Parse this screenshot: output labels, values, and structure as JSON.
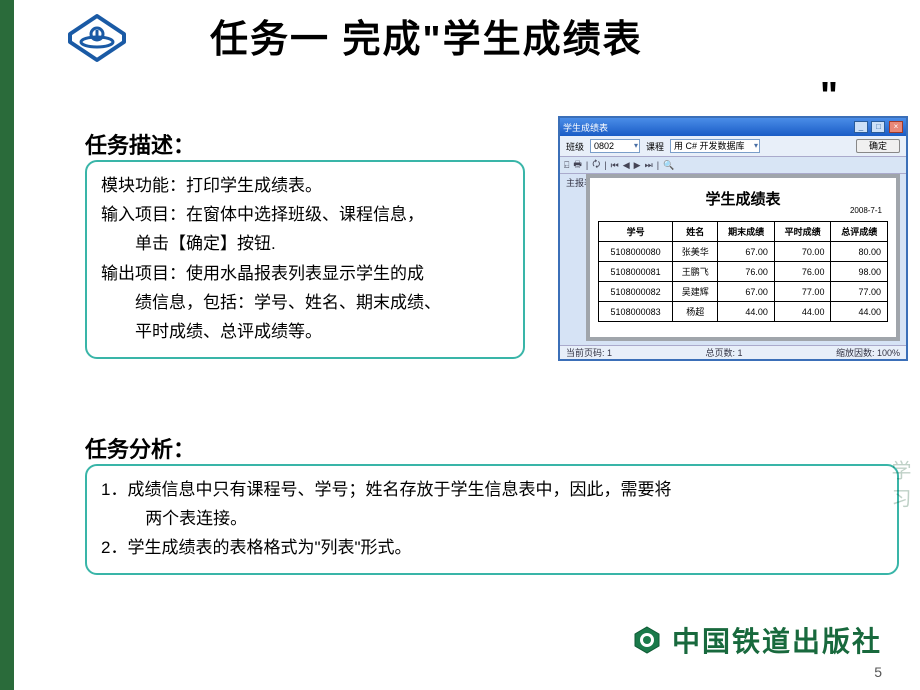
{
  "slide": {
    "title": "任务一  完成\"学生成绩表",
    "title_quote_end": "\"",
    "page_number": "5"
  },
  "task_description": {
    "heading": "任务描述：",
    "line_module": "模块功能：打印学生成绩表。",
    "line_input_a": "输入项目：在窗体中选择班级、课程信息，",
    "line_input_b": "单击【确定】按钮.",
    "line_output_a": "输出项目：使用水晶报表列表显示学生的成",
    "line_output_b": "绩信息，包括：学号、姓名、期末成绩、",
    "line_output_c": "平时成绩、总评成绩等。"
  },
  "task_analysis": {
    "heading": "任务分析：",
    "item1_a": "1．成绩信息中只有课程号、学号；姓名存放于学生信息表中，因此，需要将",
    "item1_b": "两个表连接。",
    "item2": "2．学生成绩表的表格格式为\"列表\"形式。"
  },
  "app": {
    "window_title": "学生成绩表",
    "label_class": "班级",
    "combo_class_value": "0802",
    "label_course": "课程",
    "combo_course_value": "用 C# 开发数据库",
    "btn_ok": "确定",
    "sidebar_label": "主报表",
    "report_title": "学生成绩表",
    "report_date": "2008-7-1",
    "headers": [
      "学号",
      "姓名",
      "期末成绩",
      "平时成绩",
      "总评成绩"
    ],
    "rows": [
      {
        "id": "5108000080",
        "name": "张美华",
        "final": "67.00",
        "usual": "70.00",
        "total": "80.00"
      },
      {
        "id": "5108000081",
        "name": "王鹏飞",
        "final": "76.00",
        "usual": "76.00",
        "total": "98.00"
      },
      {
        "id": "5108000082",
        "name": "吴建辉",
        "final": "67.00",
        "usual": "77.00",
        "total": "77.00"
      },
      {
        "id": "5108000083",
        "name": "杨超",
        "final": "44.00",
        "usual": "44.00",
        "total": "44.00"
      }
    ],
    "status_current": "当前页码: 1",
    "status_total": "总页数: 1",
    "status_zoom": "缩放因数: 100%"
  },
  "footer": {
    "publisher": "中国铁道出版社"
  },
  "watermark": "学习"
}
